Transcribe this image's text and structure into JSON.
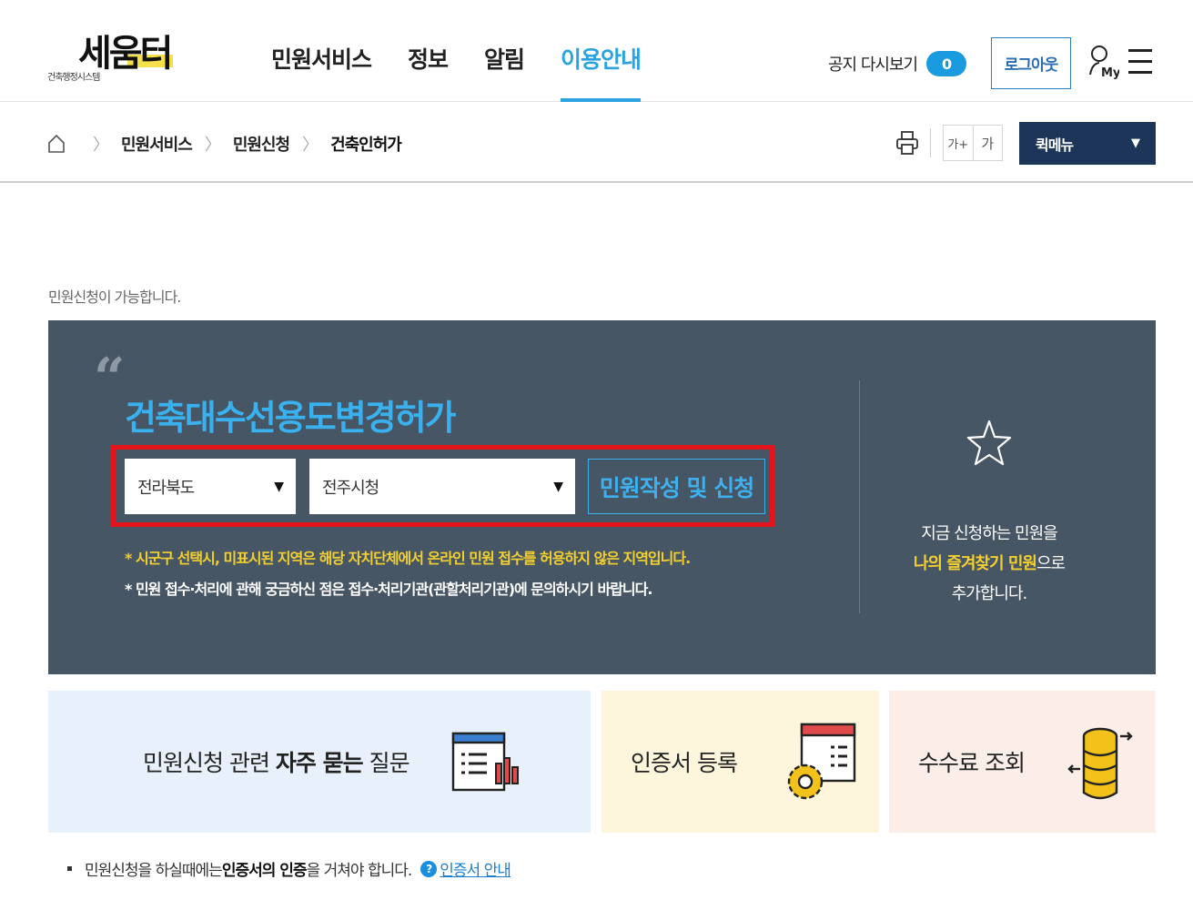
{
  "header": {
    "logo_main": "세움터",
    "logo_sub": "건축행정시스템",
    "nav": [
      "민원서비스",
      "정보",
      "알림",
      "이용안내"
    ],
    "notice_label": "공지 다시보기",
    "notice_count": "0",
    "logout_label": "로그아웃",
    "my_label": "My"
  },
  "breadcrumb": {
    "items": [
      "민원서비스",
      "민원신청",
      "건축인허가"
    ]
  },
  "toolbar": {
    "font_up": "가+",
    "font_down": "가",
    "quick_menu": "퀵메뉴"
  },
  "status_text": "민원신청이 가능합니다.",
  "panel": {
    "title": "건축대수선용도변경허가",
    "province": "전라북도",
    "city": "전주시청",
    "apply_button": "민원작성 및 신청",
    "note_warning": "* 시군구 선택시, 미표시된 지역은 해당 자치단체에서 온라인 민원 접수를 허용하지 않은 지역입니다.",
    "note_info": "* 민원 접수·처리에 관해 궁금하신 점은 접수·처리기관(관할처리기관)에 문의하시기 바랍니다.",
    "fav_line1": "지금 신청하는 민원을",
    "fav_highlight": "나의 즐겨찾기 민원",
    "fav_suffix": "으로",
    "fav_line3": "추가합니다."
  },
  "cards": {
    "faq_prefix": "민원신청 관련 ",
    "faq_bold": "자주 묻는",
    "faq_suffix": " 질문",
    "cert": "인증서 등록",
    "fee": "수수료 조회"
  },
  "footer": {
    "text_a": "민원신청을 하실때에는 ",
    "text_bold": "인증서의 인증",
    "text_b": "을 거쳐야 합니다.",
    "help": "?",
    "link": "인증서 안내"
  },
  "colors": {
    "accent": "#2aa3e0",
    "panel_bg": "#465664",
    "highlight": "#f4d02f",
    "quick_bg": "#1c3558",
    "red_box": "#e4141c"
  }
}
